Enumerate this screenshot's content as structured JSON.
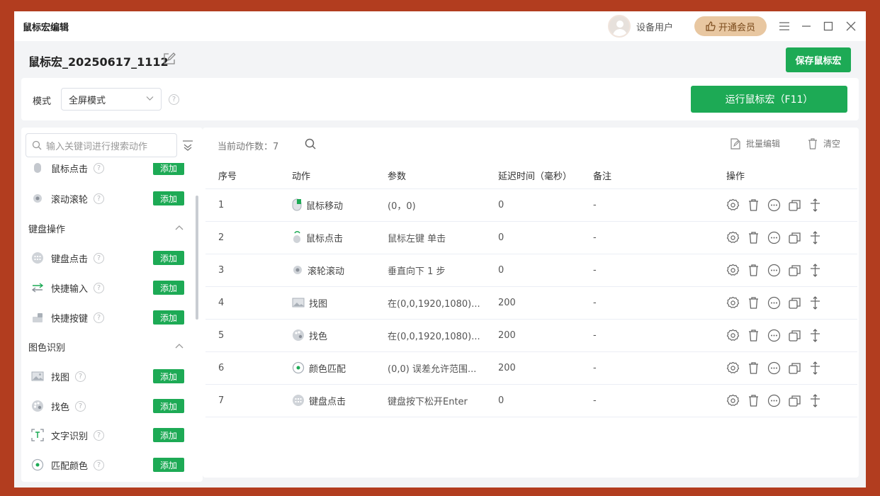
{
  "titlebar": {
    "title": "鼠标宏编辑",
    "username": "设备用户",
    "vip_label": "开通会员",
    "icons": [
      "menu-icon",
      "minimize-icon",
      "maximize-icon",
      "close-icon"
    ]
  },
  "macro": {
    "name": "鼠标宏_20250617_1112",
    "save_label": "保存鼠标宏"
  },
  "mode": {
    "label": "模式",
    "selected": "全屏模式",
    "run_label": "运行鼠标宏（F11）"
  },
  "sidebar": {
    "search_placeholder": "输入关键词进行搜索动作",
    "partial_item": {
      "label": "鼠标点击",
      "add": "添加"
    },
    "items_top": [
      {
        "label": "滚动滚轮",
        "add": "添加",
        "icon": "scroll-wheel-icon"
      }
    ],
    "categories": [
      {
        "title": "键盘操作",
        "items": [
          {
            "label": "键盘点击",
            "add": "添加",
            "icon": "keyboard-icon"
          },
          {
            "label": "快捷输入",
            "add": "添加",
            "icon": "quick-input-icon"
          },
          {
            "label": "快捷按键",
            "add": "添加",
            "icon": "hotkey-icon"
          }
        ]
      },
      {
        "title": "图色识别",
        "items": [
          {
            "label": "找图",
            "add": "添加",
            "icon": "image-icon"
          },
          {
            "label": "找色",
            "add": "添加",
            "icon": "palette-icon"
          },
          {
            "label": "文字识别",
            "add": "添加",
            "icon": "text-recognition-icon"
          },
          {
            "label": "匹配颜色",
            "add": "添加",
            "icon": "color-match-icon"
          }
        ]
      }
    ]
  },
  "main": {
    "count_label": "当前动作数：7",
    "bulk_edit": "批量编辑",
    "clear": "清空",
    "columns": [
      "序号",
      "动作",
      "参数",
      "延迟时间（毫秒）",
      "备注",
      "操作"
    ],
    "rows": [
      {
        "index": "1",
        "action": "鼠标移动",
        "icon": "mouse-move-icon",
        "params": "(0，0)",
        "delay": "0",
        "note": "-"
      },
      {
        "index": "2",
        "action": "鼠标点击",
        "icon": "mouse-click-icon",
        "params": "鼠标左键 单击",
        "delay": "0",
        "note": "-"
      },
      {
        "index": "3",
        "action": "滚轮滚动",
        "icon": "scroll-wheel-icon",
        "params": "垂直向下 1 步",
        "delay": "0",
        "note": "-"
      },
      {
        "index": "4",
        "action": "找图",
        "icon": "image-icon",
        "params": "在(0,0,1920,1080)...",
        "delay": "200",
        "note": "-"
      },
      {
        "index": "5",
        "action": "找色",
        "icon": "palette-icon",
        "params": "在(0,0,1920,1080)...",
        "delay": "200",
        "note": "-"
      },
      {
        "index": "6",
        "action": "颜色匹配",
        "icon": "color-match-icon",
        "params": "(0,0) 误差允许范围...",
        "delay": "200",
        "note": "-"
      },
      {
        "index": "7",
        "action": "键盘点击",
        "icon": "keyboard-icon",
        "params": "键盘按下松开Enter",
        "delay": "0",
        "note": "-"
      }
    ],
    "row_ops": [
      "settings-icon",
      "delete-icon",
      "more-icon",
      "copy-icon",
      "drag-handle-icon"
    ]
  },
  "colors": {
    "accent": "#1daa55",
    "frame": "#b23d1f",
    "vip": "#e8c7a1"
  }
}
